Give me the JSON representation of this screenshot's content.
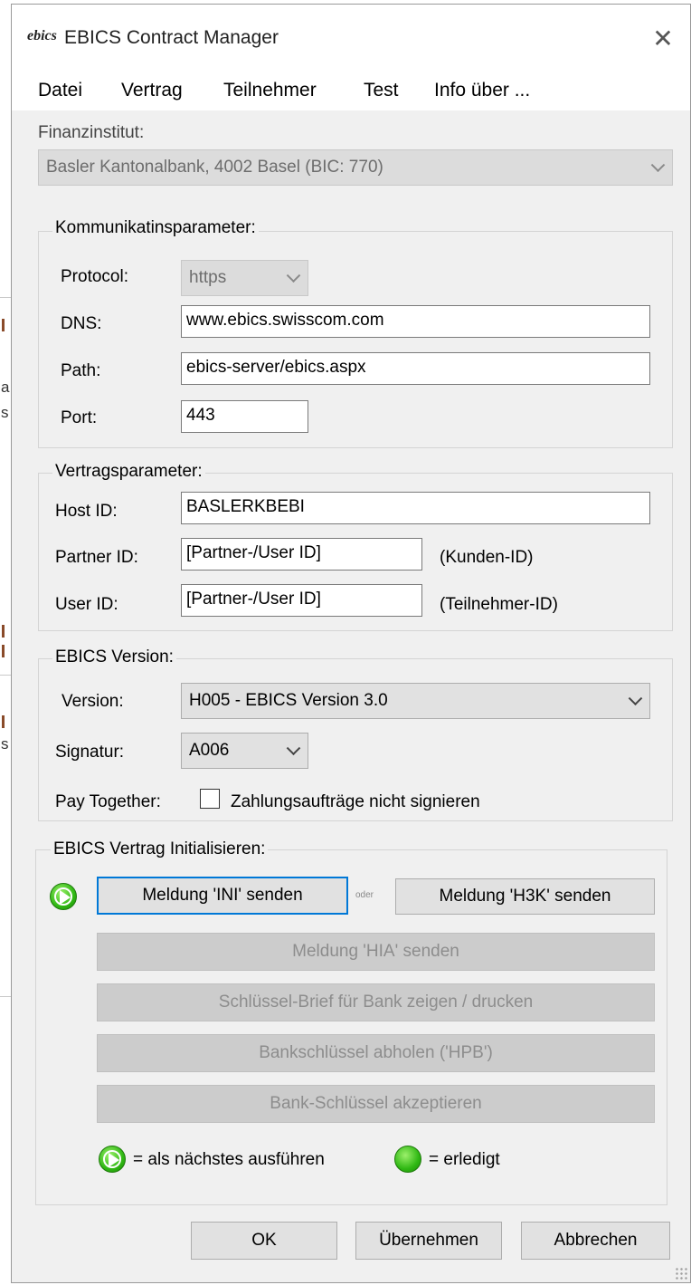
{
  "window": {
    "title": "EBICS Contract Manager",
    "logo_text": "ebics",
    "close_glyph": "✕"
  },
  "menu": [
    "Datei",
    "Vertrag",
    "Teilnehmer",
    "Test",
    "Info über ..."
  ],
  "institution": {
    "label": "Finanzinstitut:",
    "value": "Basler Kantonalbank, 4002 Basel (BIC: 770)"
  },
  "comm": {
    "title": "Kommunikatinsparameter:",
    "protocol_label": "Protocol:",
    "protocol_value": "https",
    "dns_label": "DNS:",
    "dns_value": "www.ebics.swisscom.com",
    "path_label": "Path:",
    "path_value": "ebics-server/ebics.aspx",
    "port_label": "Port:",
    "port_value": "443"
  },
  "contract": {
    "title": "Vertragsparameter:",
    "host_label": "Host ID:",
    "host_value": "BASLERKBEBI",
    "partner_label": "Partner ID:",
    "partner_value": "[Partner-/User ID]",
    "partner_hint": "(Kunden-ID)",
    "user_label": "User ID:",
    "user_value": "[Partner-/User ID]",
    "user_hint": "(Teilnehmer-ID)"
  },
  "version": {
    "title": "EBICS Version:",
    "version_label": "Version:",
    "version_value": "H005 - EBICS Version 3.0",
    "signature_label": "Signatur:",
    "signature_value": "A006",
    "pay_label": "Pay Together:",
    "pay_checkbox_label": "Zahlungsaufträge nicht signieren"
  },
  "init": {
    "title": "EBICS Vertrag Initialisieren:",
    "ini_button": "Meldung 'INI' senden",
    "oder": "oder",
    "h3k_button": "Meldung 'H3K' senden",
    "hia_button": "Meldung 'HIA' senden",
    "letter_button": "Schlüssel-Brief für Bank zeigen / drucken",
    "hpb_button": "Bankschlüssel abholen ('HPB')",
    "accept_button": "Bank-Schlüssel akzeptieren",
    "legend_next": "= als nächstes ausführen",
    "legend_done": "= erledigt"
  },
  "footer": {
    "ok": "OK",
    "apply": "Übernehmen",
    "cancel": "Abbrechen"
  },
  "background_fragments": [
    "a",
    "s",
    "s"
  ],
  "colors": {
    "accent": "#0078d7",
    "green": "#2fb813",
    "dialog_bg": "#f0f0f0"
  }
}
